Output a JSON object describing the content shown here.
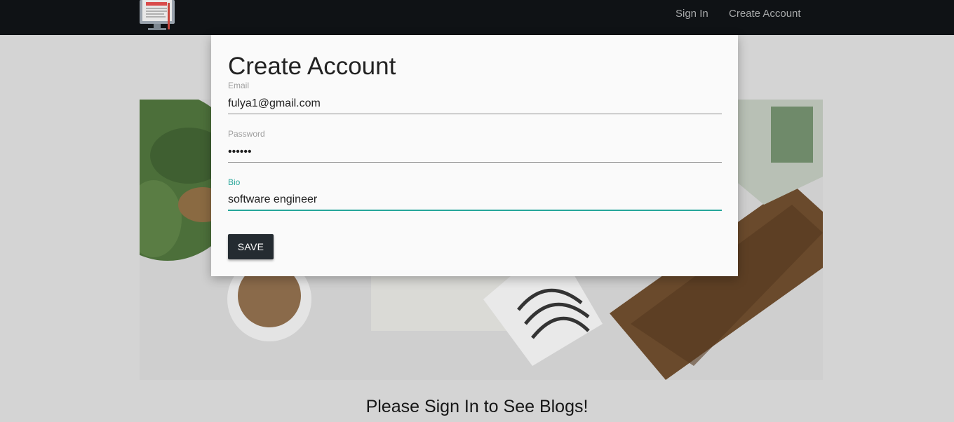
{
  "navbar": {
    "logo_icon": "computer-blog-icon",
    "links": [
      {
        "label": "Sign In"
      },
      {
        "label": "Create Account"
      }
    ]
  },
  "main": {
    "tagline": "Please Sign In to See Blogs!"
  },
  "modal": {
    "title": "Create Account",
    "fields": {
      "email": {
        "label": "Email",
        "value": "fulya1@gmail.com"
      },
      "password": {
        "label": "Password",
        "value": "aaaaaa"
      },
      "bio": {
        "label": "Bio",
        "value": "software engineer"
      }
    },
    "save_label": "SAVE"
  },
  "colors": {
    "navbar": "#0f1215",
    "accent": "#26a69a",
    "button": "#242b31"
  }
}
